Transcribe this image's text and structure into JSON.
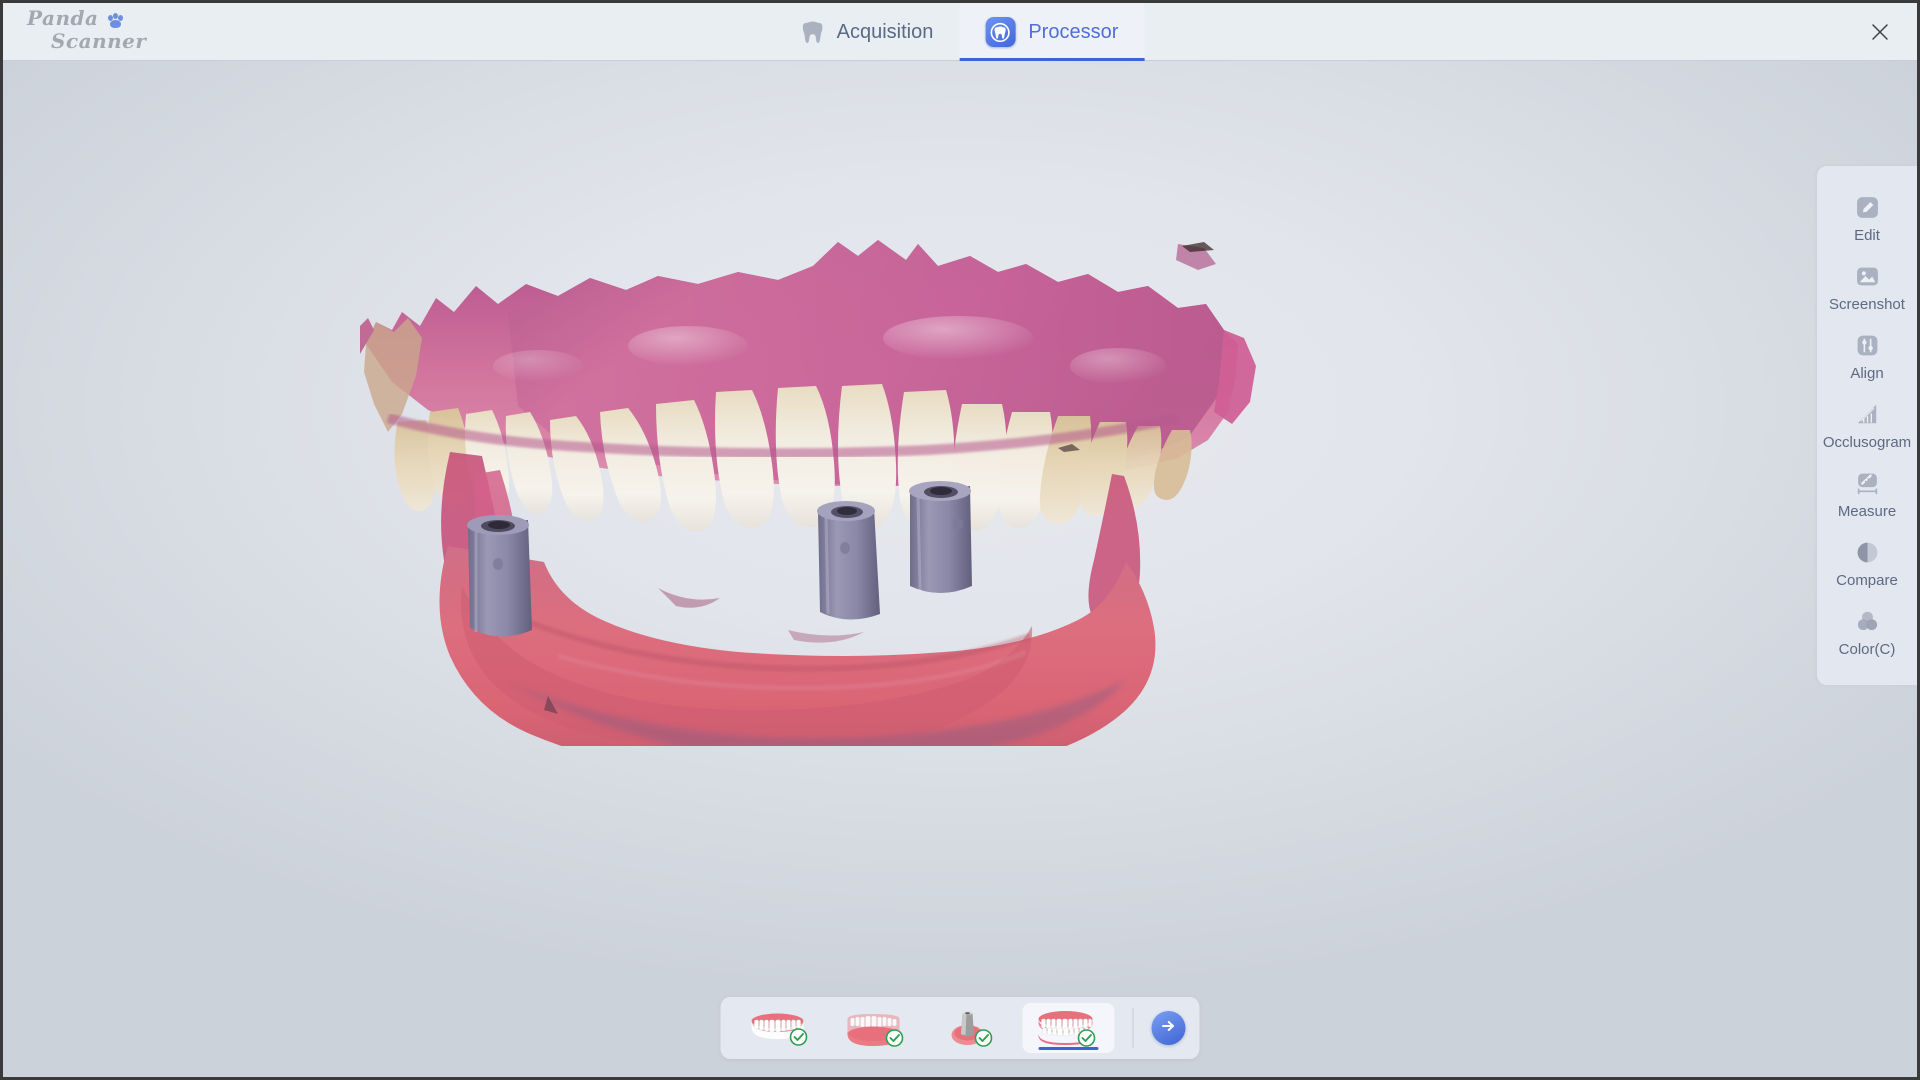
{
  "app": {
    "logo_line1": "Panda",
    "logo_line2": "Scanner",
    "logo_paw_icon": "paw-icon",
    "accent_color": "#3f63d4",
    "header_bg": "#e9eef2",
    "viewport_bg": "#e2e5eb"
  },
  "header": {
    "tabs": [
      {
        "label": "Acquisition",
        "icon": "tooth-icon",
        "active": false
      },
      {
        "label": "Processor",
        "icon": "tooth-circle-icon",
        "active": true
      }
    ],
    "close_label": "✕",
    "close_icon": "close-icon"
  },
  "sidebar": {
    "items": [
      {
        "label": "Edit",
        "icon": "pencil-square-icon"
      },
      {
        "label": "Screenshot",
        "icon": "image-icon"
      },
      {
        "label": "Align",
        "icon": "sliders-icon"
      },
      {
        "label": "Occlusogram",
        "icon": "ruler-triangle-icon"
      },
      {
        "label": "Measure",
        "icon": "caliper-icon"
      },
      {
        "label": "Compare",
        "icon": "half-circle-icon"
      },
      {
        "label": "Color(C)",
        "icon": "color-circles-icon"
      }
    ]
  },
  "bottombar": {
    "thumbnails": [
      {
        "name": "upper-arch",
        "status": "complete",
        "selected": false
      },
      {
        "name": "lower-arch",
        "status": "complete",
        "selected": false
      },
      {
        "name": "scanbody-implant",
        "status": "complete",
        "selected": false
      },
      {
        "name": "bite-occlusion",
        "status": "complete",
        "selected": true
      }
    ],
    "next_icon": "arrow-right-icon",
    "check_icon": "check-circle-icon",
    "check_color": "#2e9e4f"
  },
  "model": {
    "name": "dental-scan-3d-model",
    "description": "Full-arch intraoral scan: upper arch with natural teeth and pink gingiva, lower edentulous ridge with three implant abutments",
    "upper_gingiva_color": "#c4628f",
    "upper_tooth_color": "#efe7d4",
    "lower_gingiva_color": "#d9697a",
    "abutment_color": "#8a87a8",
    "abutment_count": 3
  }
}
